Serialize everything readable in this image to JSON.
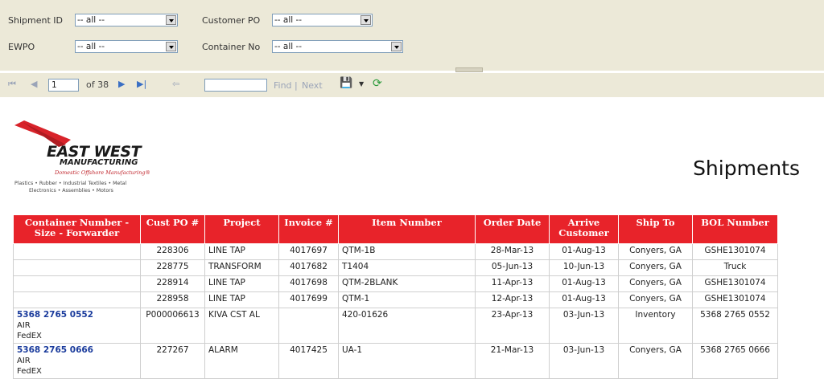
{
  "params": {
    "shipment_id": {
      "label": "Shipment ID",
      "value": "-- all --"
    },
    "customer_po": {
      "label": "Customer PO",
      "value": "-- all --"
    },
    "ewpo": {
      "label": "EWPO",
      "value": "-- all --"
    },
    "container_no": {
      "label": "Container No",
      "value": "-- all --"
    }
  },
  "toolbar": {
    "first": "⏮",
    "prev": "◀",
    "page": "1",
    "of_pages": "of 38",
    "next": "▶",
    "last": "▶|",
    "back": "⇦",
    "find": "Find",
    "separator": "|",
    "find_next": "Next",
    "export_icon": "💾",
    "refresh_icon": "⟳"
  },
  "logo": {
    "name": "EAST WEST",
    "sub": "MANUFACTURING",
    "tagline": "Domestic Offshore Manufacturing®",
    "line1": "Plastics • Rubber • Industrial Textiles • Metal",
    "line2": "Electronics • Assemblies • Motors"
  },
  "report": {
    "title": "Shipments",
    "columns": [
      "Container Number - Size - Forwarder",
      "Cust PO #",
      "Project",
      "Invoice #",
      "Item Number",
      "Order Date",
      "Arrive Customer",
      "Ship To",
      "BOL Number"
    ],
    "rows": [
      {
        "container": "",
        "size": "",
        "forwarder": "",
        "po": "228306",
        "project": "LINE TAP",
        "invoice": "4017697",
        "item": "QTM-1B",
        "order": "28-Mar-13",
        "arrive": "01-Aug-13",
        "ship_to": "Conyers, GA",
        "bol": "GSHE1301074"
      },
      {
        "container": "",
        "size": "",
        "forwarder": "",
        "po": "228775",
        "project": "TRANSFORM",
        "invoice": "4017682",
        "item": "T1404",
        "order": "05-Jun-13",
        "arrive": "10-Jun-13",
        "ship_to": "Conyers, GA",
        "bol": "Truck"
      },
      {
        "container": "",
        "size": "",
        "forwarder": "",
        "po": "228914",
        "project": "LINE TAP",
        "invoice": "4017698",
        "item": "QTM-2BLANK",
        "order": "11-Apr-13",
        "arrive": "01-Aug-13",
        "ship_to": "Conyers, GA",
        "bol": "GSHE1301074"
      },
      {
        "container": "",
        "size": "",
        "forwarder": "",
        "po": "228958",
        "project": "LINE TAP",
        "invoice": "4017699",
        "item": "QTM-1",
        "order": "12-Apr-13",
        "arrive": "01-Aug-13",
        "ship_to": "Conyers, GA",
        "bol": "GSHE1301074"
      },
      {
        "container": "5368 2765 0552",
        "size": "AIR",
        "forwarder": "FedEX",
        "po": "P000006613",
        "project": "KIVA CST AL",
        "invoice": "",
        "item": "420-01626",
        "order": "23-Apr-13",
        "arrive": "03-Jun-13",
        "ship_to": "Inventory",
        "bol": "5368 2765 0552"
      },
      {
        "container": "5368 2765 0666",
        "size": "AIR",
        "forwarder": "FedEX",
        "po": "227267",
        "project": "ALARM",
        "invoice": "4017425",
        "item": "UA-1",
        "order": "21-Mar-13",
        "arrive": "03-Jun-13",
        "ship_to": "Conyers, GA",
        "bol": "5368 2765 0666"
      }
    ]
  },
  "colors": {
    "header_bg": "#e8232a",
    "link": "#1a3b9c",
    "panel": "#ece9d8"
  }
}
